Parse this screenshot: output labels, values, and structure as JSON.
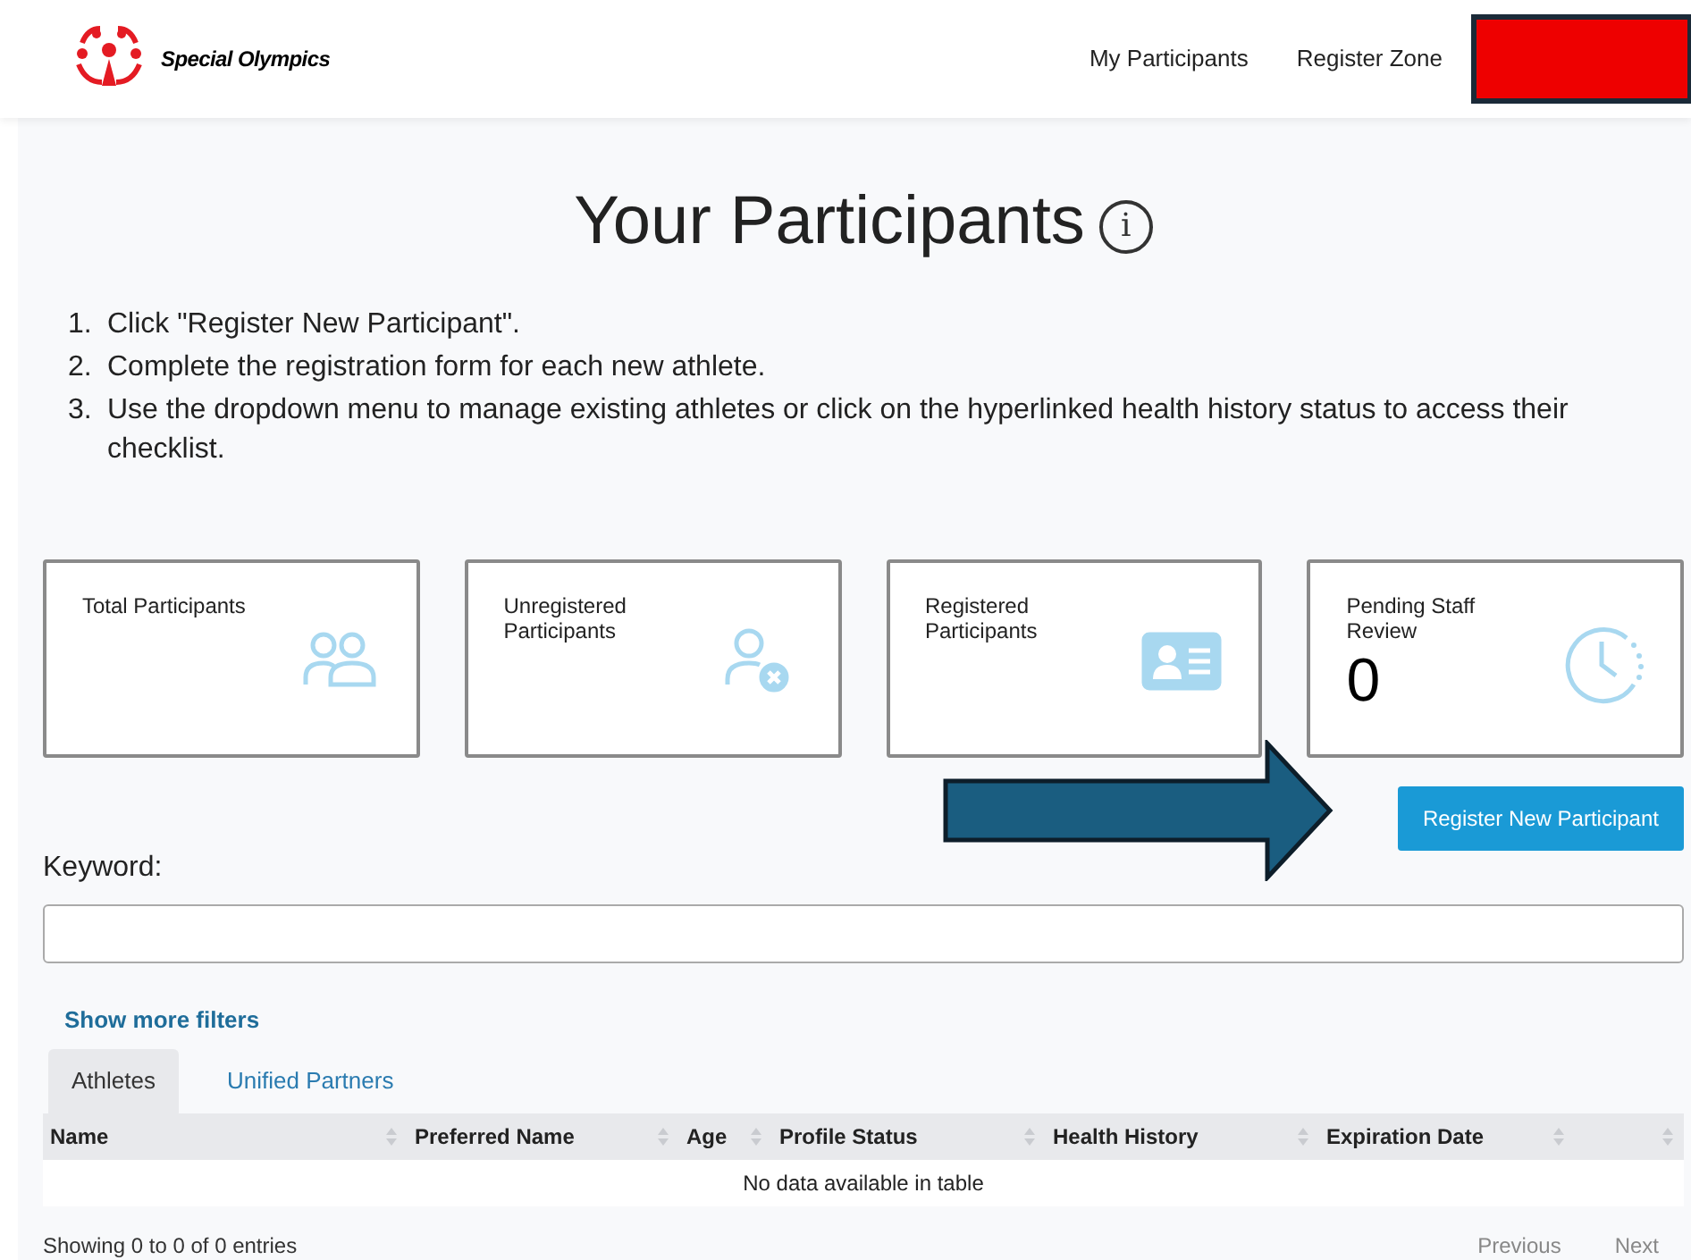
{
  "header": {
    "logo_text": "Special Olympics",
    "nav": [
      {
        "label": "My Participants"
      },
      {
        "label": "Register Zone"
      }
    ]
  },
  "page": {
    "title": "Your Participants",
    "info_icon": "i"
  },
  "steps": [
    {
      "number": "1.",
      "text": "Click \"Register New Participant\"."
    },
    {
      "number": "2.",
      "text": "Complete the registration form for each new athlete."
    },
    {
      "number": "3.",
      "text": "Use the dropdown menu to manage existing athletes or click on the hyperlinked health history status to access their checklist."
    }
  ],
  "cards": [
    {
      "label": "Total Participants",
      "kind": "people"
    },
    {
      "label": "Unregistered Participants",
      "kind": "unregistered"
    },
    {
      "label": "Registered Participants",
      "kind": "id-card"
    },
    {
      "label": "Pending Staff Review",
      "kind": "clock",
      "count": "0"
    }
  ],
  "register_button": "Register New Participant",
  "keyword": {
    "label": "Keyword:"
  },
  "show_more_filters": "Show more filters",
  "tabs": [
    {
      "label": "Athletes",
      "selected": true
    },
    {
      "label": "Unified Partners",
      "selected": false
    }
  ],
  "table": {
    "columns": [
      "Name",
      "Preferred Name",
      "Age",
      "Profile Status",
      "Health History",
      "Expiration Date",
      ""
    ],
    "empty_message": "No data available in table"
  },
  "footer": {
    "info": "Showing 0 to 0 of 0 entries",
    "previous": "Previous",
    "next": "Next"
  }
}
